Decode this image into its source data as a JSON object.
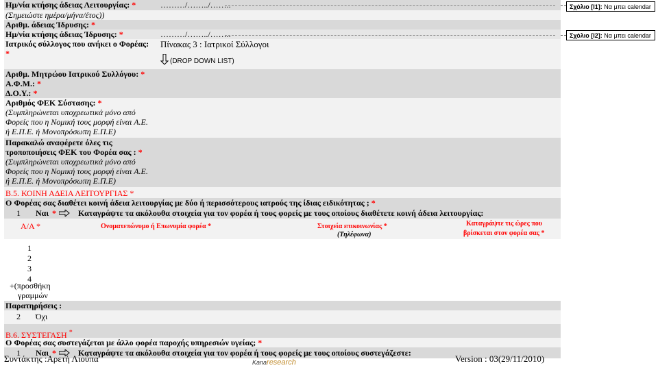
{
  "rows": {
    "r1_label": "Ημ/νία κτήσης άδειας Λειτουργίας:",
    "r1_star": "*",
    "r1_value": "………/……../……..",
    "r1_note": "(Σημειώστε ημέρα/μήνα/έτος))",
    "r2_label": "Αριθμ. άδειας Ίδρυσης:",
    "r2_star": "*",
    "r3_label": "Ημ/νία κτήσης άδειας Ίδρυσης:",
    "r3_star": "*",
    "r3_value": "………/……../……..",
    "r4_label": "Ιατρικός σύλλογος που ανήκει ο Φορέας:",
    "r4_star": "*",
    "r4_value": "Πίνακας 3 : Ιατρικοί Σύλλογοι",
    "r4_dropdown": "(DROP DOWN LIST)",
    "r5_label": "Αριθμ. Μητρώου Ιατρικού Συλλόγου:",
    "r5_star": "*",
    "r6_label": "Α.Φ.Μ.:",
    "r6_star": "*",
    "r7_label": "Δ.Ο.Υ.:",
    "r7_star": "*",
    "r8_label": "Αριθμός ΦΕΚ Σύστασης:",
    "r8_star": "*",
    "r8_note1": "(Συμπληρώνεται υποχρεωτικά μόνο από",
    "r8_note2": "Φορείς που η Νομική τους μορφή είναι Α.Ε.",
    "r8_note3": "ή Ε.Π.Ε. ή Μονοπρόσωπη Ε.Π.Ε)",
    "r9_label1": "Παρακαλώ αναφέρετε όλες τις",
    "r9_label2": "τροποποιήσεις ΦΕΚ του Φορέα σας :",
    "r9_star": "*",
    "r9_note1": "(Συμπληρώνεται υποχρεωτικά μόνο από",
    "r9_note2": "Φορείς που η Νομική τους μορφή είναι Α.Ε.",
    "r9_note3": "ή Ε.Π.Ε. ή Μονοπρόσωπη Ε.Π.Ε)"
  },
  "comments": {
    "c1_ref": "Σχόλιο [I1]:",
    "c1_text": "Να μπει calendar",
    "c2_ref": "Σχόλιο [I2]:",
    "c2_text": "Να μπει calendar"
  },
  "b5": {
    "heading": "Β.5. ΚΟΙΝΗ ΑΔΕΙΑ ΛΕΙΤΟΥΡΓΙΑΣ",
    "heading_star": "*",
    "question": "Ο Φορέας σας διαθέτει κοινή άδεια λειτουργίας με δύο ή περισσότερους ιατρούς της ίδιας ειδικότητας ;",
    "question_star": "*",
    "opt1_num": "1",
    "opt1_label": "Ναι",
    "opt1_star": "*",
    "opt1_text": "Καταγράψτε τα ακόλουθα στοιχεία για τον φορέα ή τους φορείς με τους οποίους διαθέτετε κοινή άδεια λειτουργίας:",
    "col_aa": "Α/Α",
    "col_aa_star": "*",
    "col_name": "Ονοματεπώνυμο ή Επωνυμία φορέα",
    "col_name_star": "*",
    "col_contact": "Στοιχεία επικοινωνίας",
    "col_contact_star": "*",
    "col_contact_sub": "(Τηλέφωνα)",
    "col_hours1": "Καταγράψτε τις ώρες που",
    "col_hours2": "βρίσκεται στον φορέα σας",
    "col_hours_star": "*",
    "rows": [
      "1",
      "2",
      "3",
      "4"
    ],
    "add_rows1": "+(προσθήκη",
    "add_rows2": "γραμμών",
    "remarks": "Παρατηρήσεις :",
    "opt2_num": "2",
    "opt2_label": "Όχι"
  },
  "b6": {
    "heading": "Β.6. ΣΥΣΤΕΓΑΣΗ",
    "heading_star": "*",
    "question": "Ο Φορέας σας συστεγάζεται με άλλο φορέα παροχής υπηρεσιών υγείας;",
    "question_star": "*",
    "opt1_num": "1",
    "opt1_label": "Ναι",
    "opt1_star": "*",
    "opt1_text": "Καταγράψτε τα ακόλουθα στοιχεία για τον φορέα ή τους φορείς με τους οποίους συστεγάζεστε:"
  },
  "footer": {
    "author": "Συντάκτης :Αρετή Λιούπα",
    "logo_a": "Kana",
    "logo_b": "research",
    "version": "Version : 03(29/11/2010)"
  },
  "colors": {
    "accent_red": "#ff0000",
    "row_gray": "#d9d9d9",
    "row_light": "#f2f2f2"
  }
}
